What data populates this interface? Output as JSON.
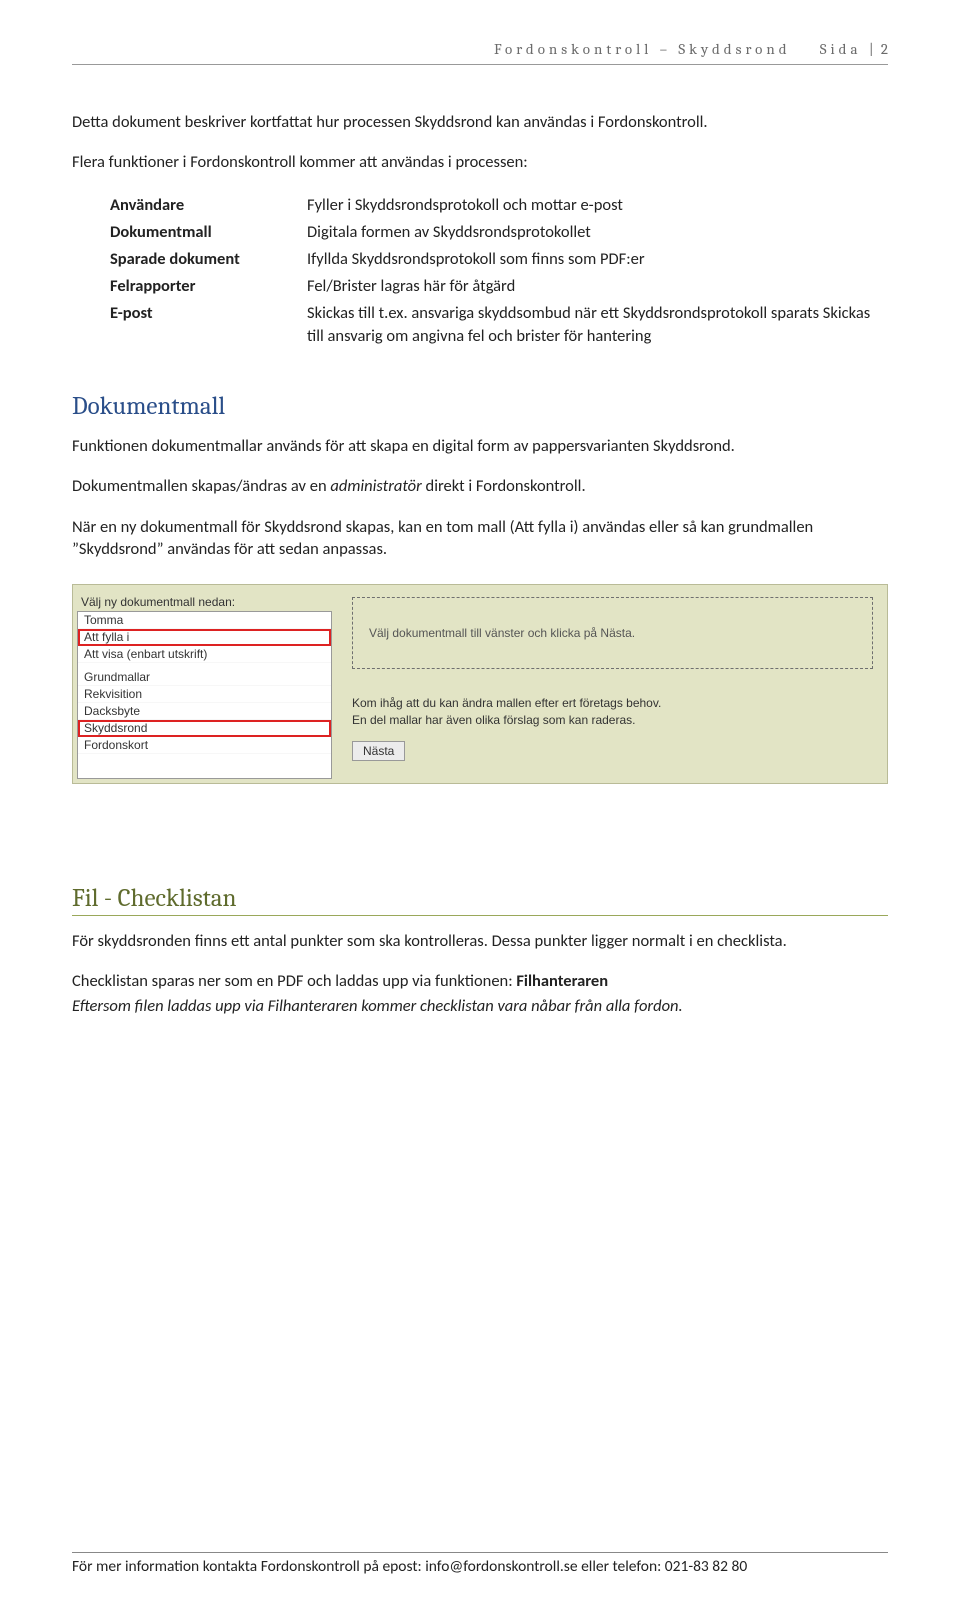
{
  "header": {
    "left": "Fordonskontroll – Skyddsrond",
    "right_label": "Sida",
    "page": "2"
  },
  "intro": {
    "p1": "Detta dokument beskriver kortfattat hur processen Skyddsrond kan användas i Fordonskontroll.",
    "p2": "Flera funktioner i Fordonskontroll kommer att användas i processen:"
  },
  "definitions": {
    "rows": [
      {
        "k": "Användare",
        "v": "Fyller i Skyddsrondsprotokoll och mottar e-post"
      },
      {
        "k": "Dokumentmall",
        "v": "Digitala formen av Skyddsrondsprotokollet"
      },
      {
        "k": "Sparade dokument",
        "v": "Ifyllda Skyddsrondsprotokoll som finns som PDF:er"
      },
      {
        "k": "Felrapporter",
        "v": "Fel/Brister lagras här för åtgärd"
      },
      {
        "k": "E-post",
        "v": "Skickas till t.ex. ansvariga skyddsombud när ett Skyddsrondsprotokoll sparats Skickas till ansvarig om angivna fel och brister för hantering"
      }
    ]
  },
  "dokumentmall": {
    "title": "Dokumentmall",
    "p1": "Funktionen dokumentmallar används för att skapa en digital form av pappersvarianten Skyddsrond.",
    "p2a": "Dokumentmallen skapas/ändras av en ",
    "p2italic": "administratör",
    "p2b": " direkt i Fordonskontroll.",
    "p3": "När en ny dokumentmall för Skyddsrond skapas, kan en tom mall (Att fylla i) användas eller så kan grundmallen ”Skyddsrond” användas för att sedan anpassas."
  },
  "screenshot": {
    "prompt": "Välj ny dokumentmall nedan:",
    "groups": [
      {
        "label": "Tomma",
        "items": [
          "Att fylla i",
          "Att visa (enbart utskrift)"
        ]
      },
      {
        "label": "Grundmallar",
        "items": [
          "Rekvisition",
          "Dacksbyte",
          "Skyddsrond",
          "Fordonskort"
        ]
      }
    ],
    "highlighted": [
      "Att fylla i",
      "Skyddsrond"
    ],
    "dashed_text": "Välj dokumentmall till vänster och klicka på Nästa.",
    "note_line1": "Kom ihåg att du kan ändra mallen efter ert företags behov.",
    "note_line2": "En del mallar har även olika förslag som kan raderas.",
    "button": "Nästa"
  },
  "checklistan": {
    "title": "Fil - Checklistan",
    "p1": "För skyddsronden finns ett antal punkter som ska kontrolleras. Dessa punkter ligger normalt i en checklista.",
    "p2a": "Checklistan sparas ner som en PDF och laddas upp via funktionen: ",
    "p2bold": "Filhanteraren",
    "p3italic": "Eftersom filen laddas upp via Filhanteraren kommer checklistan vara nåbar från alla fordon."
  },
  "footer": {
    "text": "För mer information kontakta Fordonskontroll på epost: info@fordonskontroll.se eller telefon: 021-83 82 80"
  }
}
